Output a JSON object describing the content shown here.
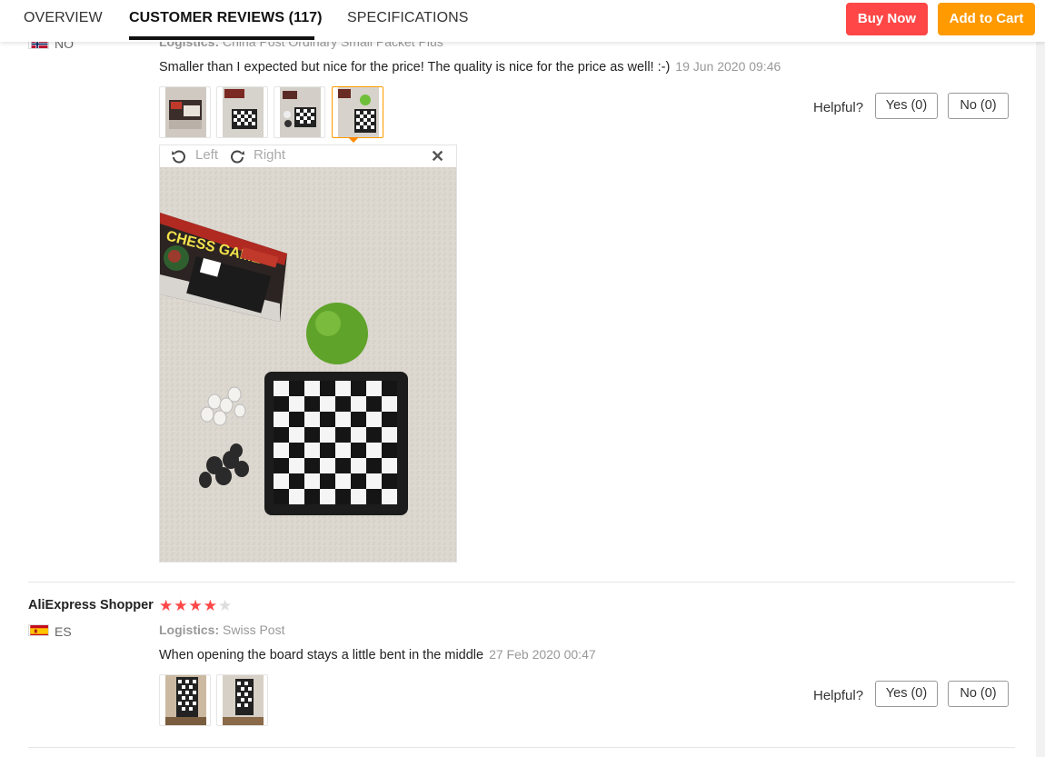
{
  "tabs": {
    "overview": "OVERVIEW",
    "reviews": "CUSTOMER REVIEWS (117)",
    "specs": "SPECIFICATIONS"
  },
  "actions": {
    "buy_now": "Buy Now",
    "add_to_cart": "Add to Cart"
  },
  "review1": {
    "country": "NO",
    "logistics_label": "Logistics:",
    "logistics_value": "China Post Ordinary Small Packet Plus",
    "text": "Smaller than I expected but nice for the price! The quality is nice for the price as well! :-)",
    "date": "19 Jun 2020 09:46",
    "helpful_label": "Helpful?",
    "yes": "Yes (0)",
    "no": "No (0)",
    "viewer": {
      "rotate_left": "Left",
      "rotate_right": "Right",
      "close": "✕"
    }
  },
  "review2": {
    "name": "AliExpress Shopper",
    "rating": 4,
    "rating_max": 5,
    "country": "ES",
    "logistics_label": "Logistics:",
    "logistics_value": "Swiss Post",
    "text": "When opening the board stays a little bent in the middle",
    "date": "27 Feb 2020 00:47",
    "helpful_label": "Helpful?",
    "yes": "Yes (0)",
    "no": "No (0)"
  },
  "colors": {
    "buy_now": "#ff4747",
    "add_to_cart": "#ff9a00",
    "star": "#ff4747",
    "active_thumb": "#ff9a00"
  }
}
